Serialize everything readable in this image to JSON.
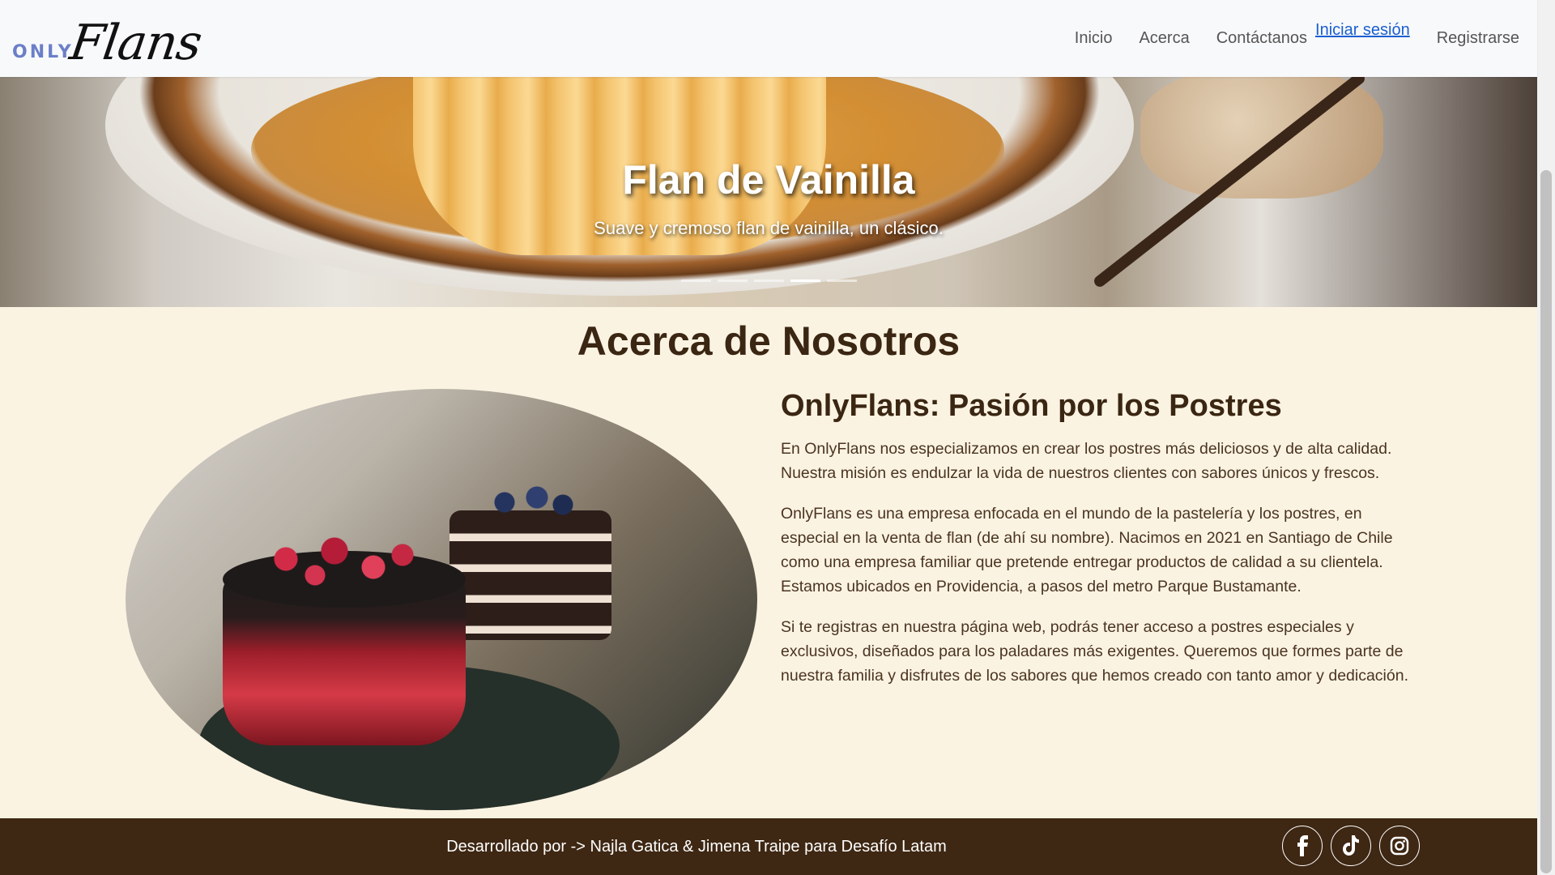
{
  "navbar": {
    "brand_only": "ONLY",
    "brand_flans": "Flans",
    "links": {
      "inicio": "Inicio",
      "acerca": "Acerca",
      "contactanos": "Contáctanos",
      "iniciar_sesion": "Iniciar sesión",
      "registrarse": "Registrarse"
    }
  },
  "hero": {
    "title": "Flan de Vainilla",
    "subtitle": "Suave y cremoso flan de vainilla, un clásico.",
    "slide_count": 5,
    "active_slide": 4
  },
  "about": {
    "title": "Acerca de Nosotros",
    "subtitle": "OnlyFlans: Pasión por los Postres",
    "paragraphs": [
      "En OnlyFlans nos especializamos en crear los postres más deliciosos y de alta calidad. Nuestra misión es endulzar la vida de nuestros clientes con sabores únicos y frescos.",
      "OnlyFlans es una empresa enfocada en el mundo de la pastelería y los postres, en especial en la venta de flan (de ahí su nombre). Nacimos en 2021 en Santiago de Chile como una empresa familiar que pretende entregar productos de calidad a su clientela. Estamos ubicados en Providencia, a pasos del metro Parque Bustamante.",
      "Si te registras en nuestra página web, podrás tener acceso a postres especiales y exclusivos, diseñados para los paladares más exigentes. Queremos que formes parte de nuestra familia y disfrutes de los sabores que hemos creado con tanto amor y dedicación."
    ]
  },
  "footer": {
    "text": "Desarrollado por -> Najla Gatica & Jimena Traipe para Desafío Latam",
    "socials": [
      "facebook-icon",
      "tiktok-icon",
      "instagram-icon"
    ]
  },
  "colors": {
    "navbar_bg": "#f8f9fb",
    "page_bg": "#fbf3e2",
    "footer_bg": "#3e2713",
    "heading": "#3a2612",
    "link": "#1a5fd0",
    "brand_only": "#6b7fc8"
  }
}
